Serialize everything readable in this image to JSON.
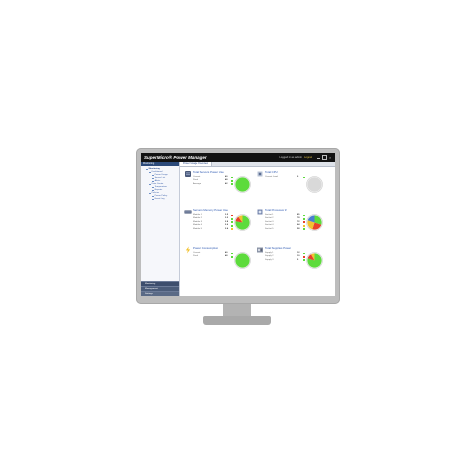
{
  "app": {
    "title": "SuperMicro® Power Manager",
    "user": "Logged in as admin",
    "logout": "Logout"
  },
  "sidebar": {
    "header": "Monitoring",
    "tree": [
      {
        "label": "Monitoring",
        "level": 1
      },
      {
        "label": "Dashboard",
        "level": 2
      },
      {
        "label": "Power Usage",
        "level": 3
      },
      {
        "label": "Server List",
        "level": 3
      },
      {
        "label": "Alerts",
        "level": 3
      },
      {
        "label": "Data Center",
        "level": 2
      },
      {
        "label": "Temperature",
        "level": 3
      },
      {
        "label": "Reports",
        "level": 3
      },
      {
        "label": "Policies",
        "level": 2
      },
      {
        "label": "Power Policy",
        "level": 3
      },
      {
        "label": "Event Log",
        "level": 3
      }
    ],
    "footer": [
      "Monitoring",
      "Management",
      "Settings"
    ]
  },
  "main": {
    "tab": "Power Usage Overview",
    "panels": [
      {
        "title": "Total Servers Power Use",
        "icon": "server-icon",
        "gauge_color": "#5ddb3c",
        "metrics": [
          {
            "label": "Current",
            "value": "40",
            "status": "#5ddb3c"
          },
          {
            "label": "Peak",
            "value": "48",
            "status": "#5ddb3c"
          },
          {
            "label": "Average",
            "value": "42",
            "status": "#5ddb3c"
          }
        ]
      },
      {
        "title": "Total CPU",
        "icon": "cpu-icon",
        "gauge_color": "#d9d9d9",
        "metrics": [
          {
            "label": "Current Load",
            "value": "0",
            "status": "#5ddb3c"
          }
        ]
      },
      {
        "title": "Servers Memory Power Use",
        "icon": "memory-icon",
        "gauge_color": "#5ddb3c",
        "pie": [
          0.78,
          0.12,
          0.1
        ],
        "metrics": [
          {
            "label": "Module 1",
            "value": "3.5",
            "status": "#e8412b"
          },
          {
            "label": "Module 2",
            "value": "3.2",
            "status": "#5ddb3c"
          },
          {
            "label": "Module 3",
            "value": "2.8",
            "status": "#5ddb3c"
          },
          {
            "label": "Module 4",
            "value": "2.6",
            "status": "#5ddb3c"
          },
          {
            "label": "Module 5",
            "value": "2.4",
            "status": "#f2c230"
          }
        ]
      },
      {
        "title": "Total Processor #",
        "icon": "processor-icon",
        "gauge_color": "#5ddb3c",
        "pie": [
          0.3,
          0.25,
          0.25,
          0.2
        ],
        "metrics": [
          {
            "label": "Socket 1",
            "value": "85",
            "status": "#5ddb3c"
          },
          {
            "label": "Socket 2",
            "value": "78",
            "status": "#5ddb3c"
          },
          {
            "label": "Socket 3",
            "value": "72",
            "status": "#e8412b"
          },
          {
            "label": "Socket 4",
            "value": "64",
            "status": "#f2c230"
          },
          {
            "label": "Socket 5",
            "value": "58",
            "status": "#5ddb3c"
          }
        ]
      },
      {
        "title": "Power Consumption",
        "icon": "lightning-icon",
        "gauge_color": "#5ddb3c",
        "metrics": [
          {
            "label": "Current",
            "value": "40",
            "status": "#5ddb3c"
          },
          {
            "label": "Peak",
            "value": "48",
            "status": "#5ddb3c"
          }
        ]
      },
      {
        "title": "Total Supplies Power",
        "icon": "power-supply-icon",
        "gauge_color": "#5ddb3c",
        "pie": [
          0.8,
          0.12,
          0.08
        ],
        "metrics": [
          {
            "label": "Supply 1",
            "value": "12",
            "status": "#5ddb3c"
          },
          {
            "label": "Supply 2",
            "value": "10",
            "status": "#e8412b"
          },
          {
            "label": "Supply 3",
            "value": "9",
            "status": "#5ddb3c"
          }
        ]
      }
    ]
  },
  "colors": {
    "titlebar": "#121212",
    "link": "#2a56b0",
    "ok": "#5ddb3c",
    "warn": "#f2c230",
    "critical": "#e8412b"
  }
}
